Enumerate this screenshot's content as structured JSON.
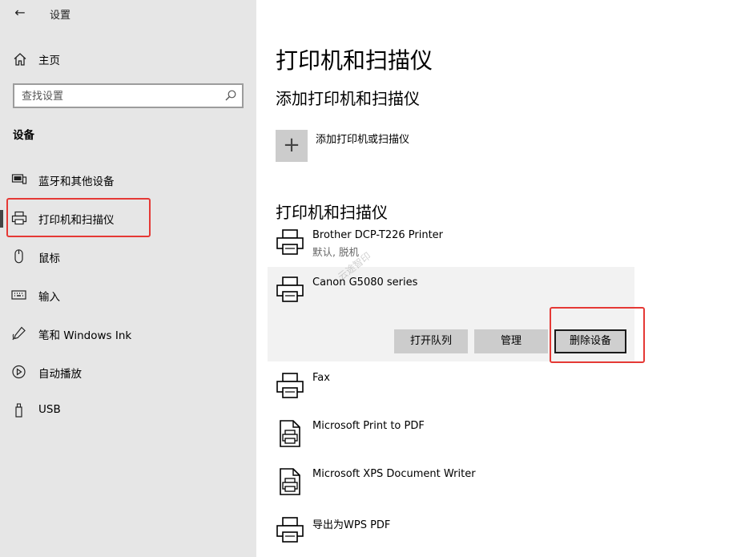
{
  "window": {
    "title": "设置",
    "back_label": "←"
  },
  "sidebar": {
    "home_label": "主页",
    "search_placeholder": "查找设置",
    "section_heading": "设备",
    "items": [
      {
        "label": "蓝牙和其他设备",
        "icon": "bluetooth-devices-icon"
      },
      {
        "label": "打印机和扫描仪",
        "icon": "printer-icon",
        "active": true
      },
      {
        "label": "鼠标",
        "icon": "mouse-icon"
      },
      {
        "label": "输入",
        "icon": "keyboard-icon"
      },
      {
        "label": "笔和 Windows Ink",
        "icon": "pen-icon"
      },
      {
        "label": "自动播放",
        "icon": "autoplay-icon"
      },
      {
        "label": "USB",
        "icon": "usb-icon"
      }
    ]
  },
  "main": {
    "title": "打印机和扫描仪",
    "add_heading": "添加打印机和扫描仪",
    "add_label": "添加打印机或扫描仪",
    "add_symbol": "+",
    "list_heading": "打印机和扫描仪",
    "devices": [
      {
        "name": "Brother DCP-T226 Printer",
        "status": "默认, 脱机",
        "icon": "printer-icon"
      },
      {
        "name": "Canon G5080 series",
        "icon": "printer-icon",
        "selected": true
      },
      {
        "name": "Fax",
        "icon": "printer-icon"
      },
      {
        "name": "Microsoft Print to PDF",
        "icon": "document-printer-icon"
      },
      {
        "name": "Microsoft XPS Document Writer",
        "icon": "document-printer-icon"
      },
      {
        "name": "导出为WPS PDF",
        "icon": "printer-icon"
      }
    ],
    "actions": {
      "open_queue": "打开队列",
      "manage": "管理",
      "remove": "删除设备"
    },
    "watermark": "云途智印"
  },
  "colors": {
    "sidebar_bg": "#e6e6e6",
    "highlight": "#e53935",
    "button_bg": "#cccccc",
    "selected_bg": "#f2f2f2"
  }
}
